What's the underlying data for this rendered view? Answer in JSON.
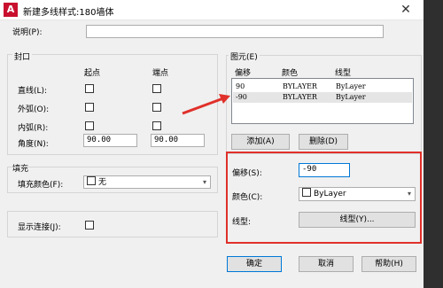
{
  "window": {
    "title": "新建多线样式:180墙体",
    "close": "✕"
  },
  "description": {
    "label": "说明(P):",
    "value": ""
  },
  "caps": {
    "group_title": "封口",
    "col_start": "起点",
    "col_end": "端点",
    "rows": [
      {
        "label": "直线(L):"
      },
      {
        "label": "外弧(O):"
      },
      {
        "label": "内弧(R):"
      }
    ],
    "angle_label": "角度(N):",
    "angle_start": "90.00",
    "angle_end": "90.00"
  },
  "fill": {
    "group_title": "填充",
    "color_label": "填充颜色(F):",
    "color_value": "无"
  },
  "show_joints": {
    "label": "显示连接(J):"
  },
  "elements": {
    "group_title": "图元(E)",
    "headers": {
      "offset": "偏移",
      "color": "颜色",
      "linetype": "线型"
    },
    "rows": [
      {
        "offset": "90",
        "color": "BYLAYER",
        "linetype": "ByLayer"
      },
      {
        "offset": "-90",
        "color": "BYLAYER",
        "linetype": "ByLayer"
      }
    ],
    "add_button": "添加(A)",
    "delete_button": "删除(D)",
    "offset_label": "偏移(S):",
    "offset_value": "-90",
    "color_label": "颜色(C):",
    "color_value": "ByLayer",
    "linetype_label": "线型:",
    "linetype_button": "线型(Y)..."
  },
  "footer": {
    "ok": "确定",
    "cancel": "取消",
    "help": "帮助(H)"
  },
  "colors": {
    "highlight": "#e0302a",
    "focus": "#0078d7"
  }
}
